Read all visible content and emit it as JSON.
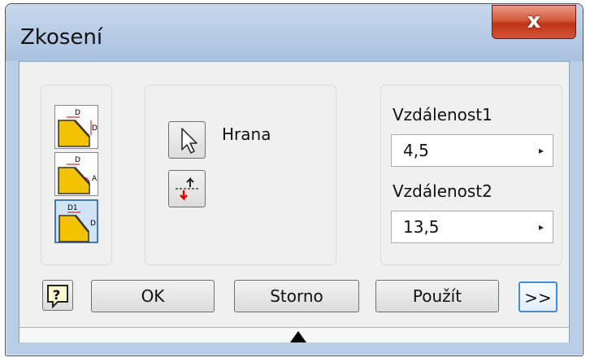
{
  "window": {
    "title": "Zkosení",
    "close_label": "x"
  },
  "edge_group": {
    "edge_label": "Hrana"
  },
  "distances": {
    "label1": "Vzdálenost1",
    "value1": "4,5",
    "label2": "Vzdálenost2",
    "value2": "13,5",
    "arrow": "▸"
  },
  "buttons": {
    "help": "?",
    "ok": "OK",
    "cancel": "Storno",
    "apply": "Použít",
    "more": ">>"
  },
  "chamfer_types": {
    "distance_icon_text": "D",
    "distance_angle_icon_text": "A",
    "two_distance_icon_text": "D1"
  },
  "colors": {
    "accent": "#3c8fd8",
    "close": "#c03417"
  }
}
